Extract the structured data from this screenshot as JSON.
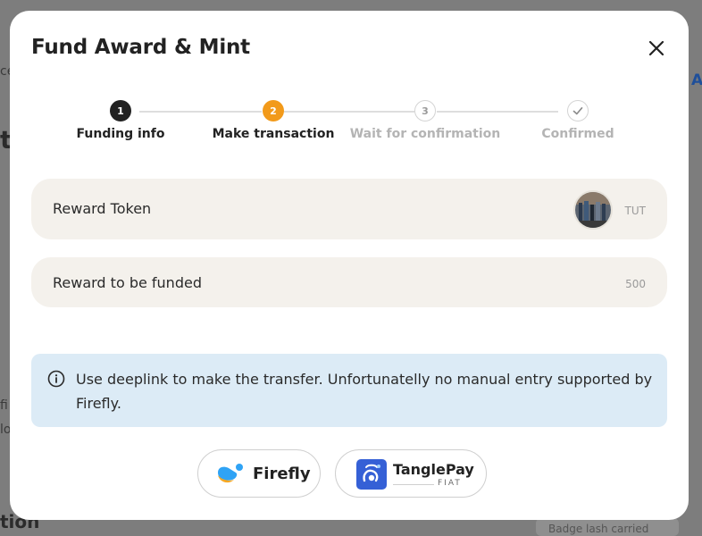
{
  "background": {
    "fragment_ce": "ce",
    "fragment_a": "A",
    "fragment_to": "to",
    "fragment_fi": "fi",
    "fragment_lo": "lo",
    "fragment_tion": "tion",
    "fragment_badge": "Badge lash carried"
  },
  "modal": {
    "title": "Fund Award & Mint",
    "close_icon": "close-icon"
  },
  "stepper": {
    "steps": [
      {
        "number": "1",
        "label": "Funding info",
        "state": "completed"
      },
      {
        "number": "2",
        "label": "Make transaction",
        "state": "active"
      },
      {
        "number": "3",
        "label": "Wait for confirmation",
        "state": "pending"
      },
      {
        "number": "",
        "label": "Confirmed",
        "state": "pending",
        "icon": "check-icon"
      }
    ],
    "colors": {
      "completed": "#222222",
      "active": "#f29a1a",
      "pending": "#c9c9c9"
    }
  },
  "fields": {
    "reward_token": {
      "label": "Reward Token",
      "value": "TUT"
    },
    "reward_funded": {
      "label": "Reward to be funded",
      "value": "500"
    }
  },
  "info": {
    "icon": "info-icon",
    "text": "Use deeplink to make the transfer. Unfortunatelly no manual entry supported by Firefly."
  },
  "wallets": {
    "firefly": {
      "label": "Firefly",
      "icon": "firefly-logo-icon"
    },
    "tanglepay": {
      "label": "TanglePay",
      "sublabel": "FIAT",
      "icon": "tanglepay-logo-icon"
    }
  }
}
